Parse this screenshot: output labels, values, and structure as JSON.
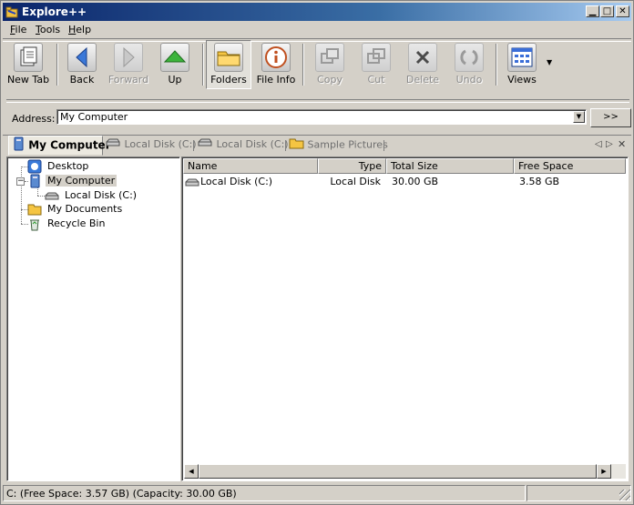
{
  "window": {
    "title": "Explore++"
  },
  "menubar": {
    "items": [
      {
        "label": "File",
        "accel": "F"
      },
      {
        "label": "Tools",
        "accel": "T"
      },
      {
        "label": "Help",
        "accel": "H"
      }
    ]
  },
  "toolbar": {
    "buttons": [
      {
        "label": "New Tab",
        "icon": "new-tab-icon",
        "enabled": true
      },
      {
        "label": "Back",
        "icon": "back-arrow-icon",
        "enabled": true
      },
      {
        "label": "Forward",
        "icon": "forward-arrow-icon",
        "enabled": false
      },
      {
        "label": "Up",
        "icon": "up-arrow-icon",
        "enabled": true
      },
      {
        "label": "Folders",
        "icon": "folders-icon",
        "enabled": true,
        "pressed": true
      },
      {
        "label": "File Info",
        "icon": "info-icon",
        "enabled": true
      },
      {
        "label": "Copy",
        "icon": "copy-icon",
        "enabled": false
      },
      {
        "label": "Cut",
        "icon": "cut-icon",
        "enabled": false
      },
      {
        "label": "Delete",
        "icon": "delete-icon",
        "enabled": false
      },
      {
        "label": "Undo",
        "icon": "undo-icon",
        "enabled": false
      },
      {
        "label": "Views",
        "icon": "views-icon",
        "enabled": true
      }
    ]
  },
  "address": {
    "label": "Address:",
    "value": "My Computer",
    "go_label": ">>"
  },
  "tabs": [
    {
      "label": "My Computer",
      "icon": "computer-icon",
      "active": true
    },
    {
      "label": "Local Disk (C:)",
      "icon": "drive-icon",
      "active": false
    },
    {
      "label": "Local Disk (C:)",
      "icon": "drive-icon",
      "active": false
    },
    {
      "label": "Sample Pictures",
      "icon": "folder-icon",
      "active": false
    }
  ],
  "tree": {
    "nodes": [
      {
        "label": "Desktop",
        "icon": "desktop-icon"
      },
      {
        "label": "My Computer",
        "icon": "computer-icon",
        "selected": true,
        "expanded": true
      },
      {
        "label": "Local Disk (C:)",
        "icon": "drive-icon"
      },
      {
        "label": "My Documents",
        "icon": "folder-icon"
      },
      {
        "label": "Recycle Bin",
        "icon": "recycle-bin-icon"
      }
    ]
  },
  "list": {
    "columns": [
      "Name",
      "Type",
      "Total Size",
      "Free Space"
    ],
    "rows": [
      {
        "name": "Local Disk (C:)",
        "type": "Local Disk",
        "total": "30.00 GB",
        "free": "3.58 GB",
        "icon": "drive-icon"
      }
    ]
  },
  "status": {
    "text": "C: (Free Space: 3.57 GB) (Capacity: 30.00 GB)"
  },
  "colors": {
    "title_start": "#0a246a",
    "title_end": "#a6caf0",
    "face": "#d4d0c8"
  }
}
